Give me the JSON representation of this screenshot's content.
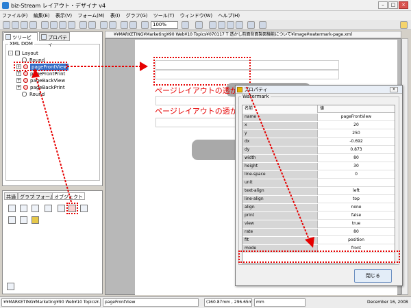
{
  "window": {
    "title": "biz-Stream レイアウト・デザイナ v4"
  },
  "menu": [
    "ファイル(F)",
    "編集(E)",
    "表示(V)",
    "フォーム(M)",
    "表(I)",
    "グラフ(G)",
    "ツール(T)",
    "ウィンドウ(W)",
    "ヘルプ(H)"
  ],
  "toolbar": {
    "zoom": "100%"
  },
  "left_panel": {
    "tabs": [
      "ツリービュー",
      "プロパティ"
    ],
    "group_label": "XML DOM",
    "tree": [
      "Layout",
      "Round",
      "pageFrontView",
      "pageFrontPrint",
      "pageBackView",
      "pageBackPrint",
      "Round"
    ]
  },
  "palette_tabs": [
    "共通",
    "グラフ",
    "フォーム",
    "オブジェクト"
  ],
  "document": {
    "path": "¥¥MARKETING¥Marketing¥90 Web¥10 Topics¥070117 T 透かし前面背面製図機能について¥image¥watermark-page.xml",
    "watermark_text_1": "ページレイアウトの透かし背面&am",
    "watermark_text_2": "ページレイアウトの透かし背面&am"
  },
  "dialog": {
    "title": "プロパティ",
    "group": "Watermark",
    "headers": {
      "name": "名前",
      "value": "値"
    },
    "rows": [
      {
        "name": "name",
        "value": "pageFrontView"
      },
      {
        "name": "x",
        "value": "20"
      },
      {
        "name": "y",
        "value": "250"
      },
      {
        "name": "dx",
        "value": "-0.692"
      },
      {
        "name": "dy",
        "value": "0.873"
      },
      {
        "name": "width",
        "value": "80"
      },
      {
        "name": "height",
        "value": "30"
      },
      {
        "name": "line-space",
        "value": "0"
      },
      {
        "name": "unit",
        "value": ""
      },
      {
        "name": "text-align",
        "value": "left"
      },
      {
        "name": "line-align",
        "value": "top"
      },
      {
        "name": "align",
        "value": "none"
      },
      {
        "name": "print",
        "value": "false"
      },
      {
        "name": "view",
        "value": "true"
      },
      {
        "name": "rate",
        "value": "80"
      },
      {
        "name": "fit",
        "value": "position"
      },
      {
        "name": "mode",
        "value": "front"
      }
    ],
    "close_label": "閉じる"
  },
  "statusbar": {
    "path": "¥¥MARKETING¥Marketing¥90 Web¥10 Topics¥...",
    "element": "pageFrontView",
    "coords": "(160.87mm , 296.65mm)",
    "unit": "mm",
    "date": "December 16, 2008"
  }
}
